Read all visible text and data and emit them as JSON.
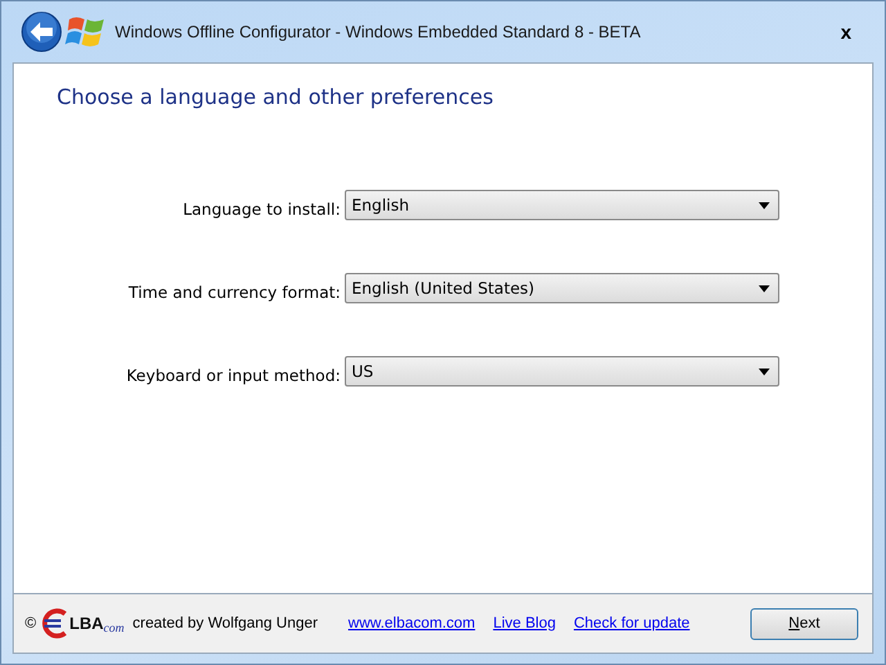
{
  "window": {
    "title": "Windows Offline Configurator - Windows Embedded Standard 8 - BETA",
    "close": "x"
  },
  "heading": "Choose a language and other preferences",
  "fields": [
    {
      "label": "Language to install:",
      "value": "English"
    },
    {
      "label": "Time and currency format:",
      "value": "English (United States)"
    },
    {
      "label": "Keyboard or input method:",
      "value": "US"
    }
  ],
  "footer": {
    "copyright": "©",
    "logo_text": "LBA",
    "logo_suffix": "com",
    "credit": "created by Wolfgang Unger",
    "links": [
      "www.elbacom.com",
      "Live Blog",
      "Check for update"
    ],
    "next_button": "Next"
  }
}
